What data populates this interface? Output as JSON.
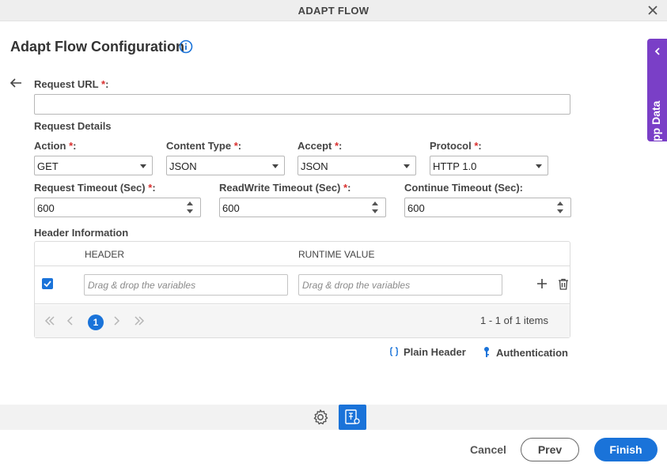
{
  "window": {
    "title": "ADAPT FLOW"
  },
  "page": {
    "title": "Adapt Flow Configuration"
  },
  "side_tab": {
    "label": "App Data"
  },
  "form": {
    "request_url_label": "Request URL",
    "request_url_value": "",
    "required_mark": "*",
    "colon": ":",
    "request_details_label": "Request Details",
    "action": {
      "label": "Action",
      "value": "GET"
    },
    "content_type": {
      "label": "Content Type",
      "value": "JSON"
    },
    "accept": {
      "label": "Accept",
      "value": "JSON"
    },
    "protocol": {
      "label": "Protocol",
      "value": "HTTP 1.0"
    },
    "request_timeout": {
      "label": "Request Timeout (Sec)",
      "value": "600"
    },
    "readwrite_timeout": {
      "label": "ReadWrite Timeout (Sec)",
      "value": "600"
    },
    "continue_timeout": {
      "label": "Continue Timeout (Sec):",
      "value": "600"
    }
  },
  "header_info": {
    "label": "Header Information",
    "columns": [
      "HEADER",
      "RUNTIME VALUE"
    ],
    "rows": [
      {
        "checked": true,
        "header_placeholder": "Drag & drop the variables",
        "value_placeholder": "Drag & drop the variables"
      }
    ],
    "pager": {
      "current_page": "1",
      "info": "1 - 1 of 1 items"
    }
  },
  "links": {
    "plain_header": "Plain Header",
    "authentication": "Authentication"
  },
  "footer": {
    "cancel": "Cancel",
    "prev": "Prev",
    "finish": "Finish"
  },
  "colors": {
    "primary": "#1a73d9",
    "side_tab": "#7a3fc7",
    "required": "#d9302f"
  }
}
